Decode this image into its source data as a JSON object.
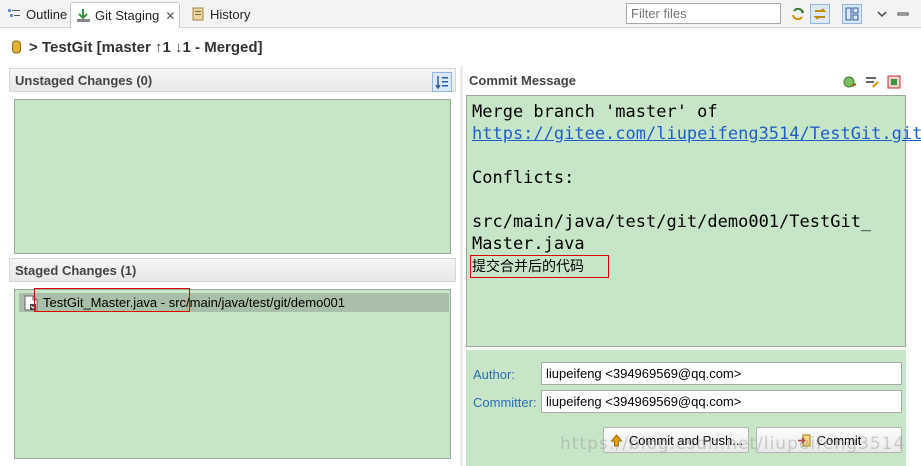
{
  "tabs": [
    {
      "label": "Outline",
      "icon": "outline-icon"
    },
    {
      "label": "Git Staging",
      "icon": "git-staging-icon",
      "active": true
    },
    {
      "label": "History",
      "icon": "history-icon"
    }
  ],
  "tab_close": "✕",
  "filter": {
    "placeholder": "Filter files"
  },
  "repo": {
    "title": "> TestGit [master ↑1 ↓1 - Merged]"
  },
  "unstaged": {
    "header": "Unstaged Changes (0)"
  },
  "staged": {
    "header": "Staged Changes (1)",
    "items": [
      {
        "label": "TestGit_Master.java - src/main/java/test/git/demo001"
      }
    ]
  },
  "commit": {
    "header": "Commit Message",
    "line1": "Merge branch 'master' of",
    "link": "https://gitee.com/liupeifeng3514/TestGit.git",
    "conflicts_label": "Conflicts:",
    "conflict_file_1": "    src/main/java/test/git/demo001/TestGit_",
    "conflict_file_2": "Master.java",
    "chinese_line": "提交合并后的代码",
    "author_label": "Author:",
    "author_value": "liupeifeng <394969569@qq.com>",
    "committer_label": "Committer:",
    "committer_value": "liupeifeng <394969569@qq.com>",
    "commit_push_label": "Commit and Push...",
    "commit_label": "Commit"
  },
  "watermark": "https://blog.csdn.net/liupeifeng3514",
  "colors": {
    "green_bg": "#c7e6c7",
    "link": "#1d5fc6",
    "label_blue": "#2a6db4",
    "highlight_red": "#dd0000"
  }
}
